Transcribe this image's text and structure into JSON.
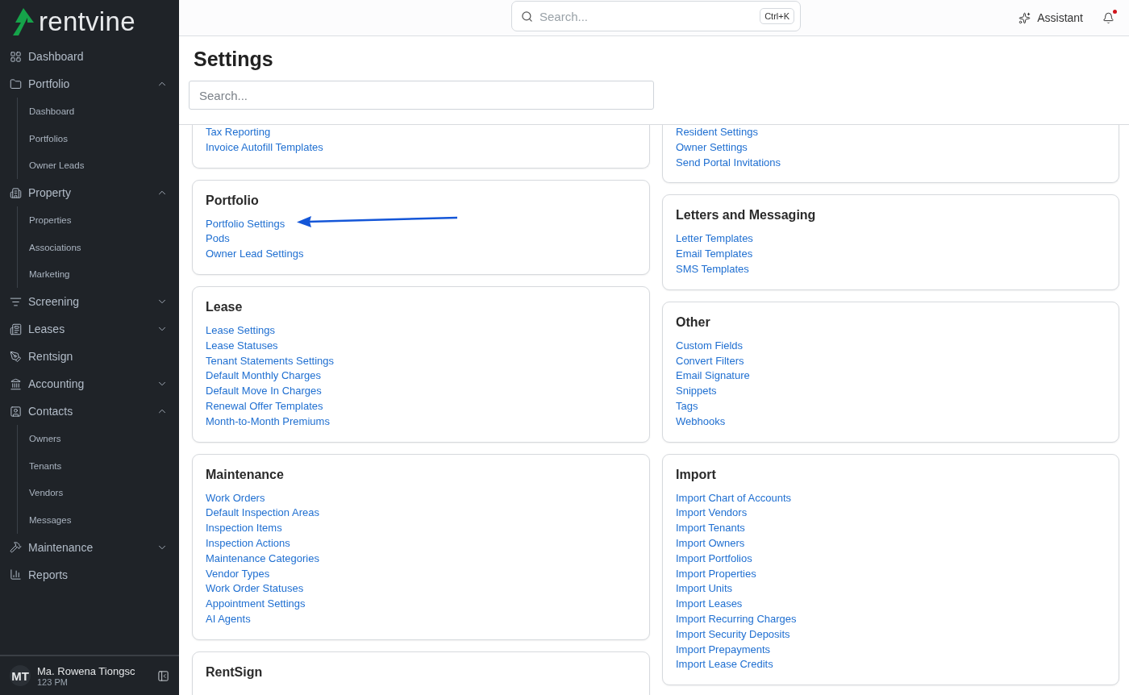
{
  "brand": {
    "name": "rentvine"
  },
  "sidebar": {
    "items": [
      {
        "kind": "link",
        "label": "Dashboard"
      },
      {
        "kind": "group",
        "label": "Portfolio",
        "expanded": true,
        "children": [
          {
            "label": "Dashboard"
          },
          {
            "label": "Portfolios"
          },
          {
            "label": "Owner Leads"
          }
        ]
      },
      {
        "kind": "group",
        "label": "Property",
        "expanded": true,
        "children": [
          {
            "label": "Properties"
          },
          {
            "label": "Associations"
          },
          {
            "label": "Marketing"
          }
        ]
      },
      {
        "kind": "group",
        "label": "Screening",
        "expanded": false
      },
      {
        "kind": "group",
        "label": "Leases",
        "expanded": false
      },
      {
        "kind": "link",
        "label": "Rentsign"
      },
      {
        "kind": "group",
        "label": "Accounting",
        "expanded": false
      },
      {
        "kind": "group",
        "label": "Contacts",
        "expanded": true,
        "children": [
          {
            "label": "Owners"
          },
          {
            "label": "Tenants"
          },
          {
            "label": "Vendors"
          },
          {
            "label": "Messages"
          }
        ]
      },
      {
        "kind": "group",
        "label": "Maintenance",
        "expanded": false
      },
      {
        "kind": "link",
        "label": "Reports"
      }
    ],
    "user": {
      "initials": "MT",
      "name": "Ma. Rowena Tiongsc",
      "detail": "123 PM"
    }
  },
  "topbar": {
    "search": {
      "placeholder": "Search...",
      "shortcut": "Ctrl+K"
    },
    "assistant": "Assistant",
    "notifications_unread": true
  },
  "page": {
    "title": "Settings",
    "search": {
      "placeholder": "Search..."
    }
  },
  "columns": [
    {
      "cards": [
        {
          "links": [
            "Tax Reporting",
            "Invoice Autofill Templates"
          ]
        },
        {
          "title": "Portfolio",
          "links": [
            "Portfolio Settings",
            "Pods",
            "Owner Lead Settings"
          ]
        },
        {
          "title": "Lease",
          "links": [
            "Lease Settings",
            "Lease Statuses",
            "Tenant Statements Settings",
            "Default Monthly Charges",
            "Default Move In Charges",
            "Renewal Offer Templates",
            "Month-to-Month Premiums"
          ]
        },
        {
          "title": "Maintenance",
          "links": [
            "Work Orders",
            "Default Inspection Areas",
            "Inspection Items",
            "Inspection Actions",
            "Maintenance Categories",
            "Vendor Types",
            "Work Order Statuses",
            "Appointment Settings",
            "AI Agents"
          ]
        },
        {
          "title": "RentSign"
        }
      ]
    },
    {
      "cards": [
        {
          "links": [
            "Resident Settings",
            "Owner Settings",
            "Send Portal Invitations"
          ]
        },
        {
          "title": "Letters and Messaging",
          "links": [
            "Letter Templates",
            "Email Templates",
            "SMS Templates"
          ]
        },
        {
          "title": "Other",
          "links": [
            "Custom Fields",
            "Convert Filters",
            "Email Signature",
            "Snippets",
            "Tags",
            "Webhooks"
          ]
        },
        {
          "title": "Import",
          "links": [
            "Import Chart of Accounts",
            "Import Vendors",
            "Import Tenants",
            "Import Owners",
            "Import Portfolios",
            "Import Properties",
            "Import Units",
            "Import Leases",
            "Import Recurring Charges",
            "Import Security Deposits",
            "Import Prepayments",
            "Import Lease Credits"
          ]
        }
      ]
    }
  ]
}
